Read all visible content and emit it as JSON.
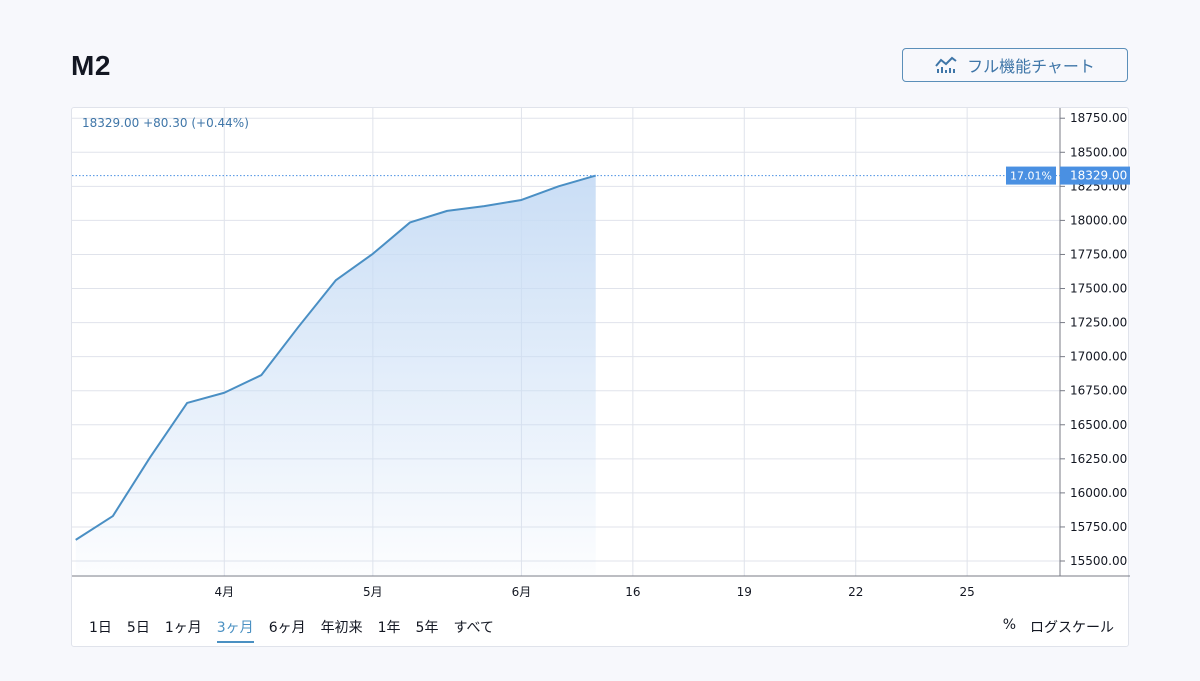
{
  "header": {
    "title": "M2",
    "full_chart_label": "フル機能チャート",
    "full_chart_icon": "chart-line-icon"
  },
  "legend": {
    "price": "18329.00",
    "change": "+80.30",
    "change_pct": "(+0.44%)"
  },
  "ranges": [
    {
      "label": "1日",
      "active": false
    },
    {
      "label": "5日",
      "active": false
    },
    {
      "label": "1ヶ月",
      "active": false
    },
    {
      "label": "3ヶ月",
      "active": true
    },
    {
      "label": "6ヶ月",
      "active": false
    },
    {
      "label": "年初来",
      "active": false
    },
    {
      "label": "1年",
      "active": false
    },
    {
      "label": "5年",
      "active": false
    },
    {
      "label": "すべて",
      "active": false
    }
  ],
  "controls": {
    "percent_label": "%",
    "log_label": "ログスケール"
  },
  "colors": {
    "line": "#4a8fc4",
    "area_top": "#c7dcf5",
    "accent": "#4a90e2",
    "grid": "#e0e3eb"
  },
  "chart_data": {
    "type": "area",
    "x_ticks": [
      {
        "label": "4月",
        "x": 6
      },
      {
        "label": "5月",
        "x": 10
      },
      {
        "label": "6月",
        "x": 14
      },
      {
        "label": "16",
        "x": 17
      },
      {
        "label": "19",
        "x": 20
      },
      {
        "label": "22",
        "x": 23
      },
      {
        "label": "25",
        "x": 26
      }
    ],
    "x_range": [
      1.9,
      28.5
    ],
    "x": [
      2,
      3,
      4,
      5,
      6,
      7,
      8,
      9,
      10,
      11,
      12,
      13,
      14,
      15,
      16
    ],
    "values": [
      15655,
      15830,
      16260,
      16660,
      16735,
      16865,
      17220,
      17560,
      17755,
      17985,
      18070,
      18105,
      18150,
      18250,
      18329
    ],
    "ylim": [
      15390,
      18825
    ],
    "y_ticks": [
      15500,
      15750,
      16000,
      16250,
      16500,
      16750,
      17000,
      17250,
      17500,
      17750,
      18000,
      18250,
      18500,
      18750
    ],
    "y_tick_labels": [
      "15500.00",
      "15750.00",
      "16000.00",
      "16250.00",
      "16500.00",
      "16750.00",
      "17000.00",
      "17250.00",
      "17500.00",
      "17750.00",
      "18000.00",
      "18250.00",
      "18500.00",
      "18750.00"
    ],
    "last_value": 18329,
    "last_value_label": "18329.00",
    "last_pct_label": "17.01%",
    "grid": true
  }
}
